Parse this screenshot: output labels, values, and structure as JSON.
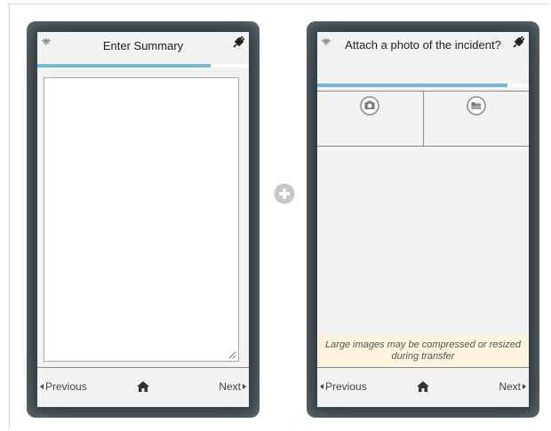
{
  "screens": [
    {
      "header": {
        "title": "Enter Summary",
        "left_icon": "compass-icon",
        "right_icon": "plug-icon"
      },
      "progress_fraction": 0.82,
      "summary_value": "",
      "footer": {
        "previous_label": "Previous",
        "home_icon": "home-icon",
        "next_label": "Next"
      }
    },
    {
      "header": {
        "title": "Attach a photo of the incident?",
        "left_icon": "compass-icon",
        "right_icon": "plug-icon"
      },
      "progress_fraction": 0.9,
      "photo_options": [
        {
          "icon": "camera-icon"
        },
        {
          "icon": "folder-icon"
        }
      ],
      "note": "Large images may be compressed or resized during transfer",
      "footer": {
        "previous_label": "Previous",
        "home_icon": "home-icon",
        "next_label": "Next"
      }
    }
  ],
  "add_button_icon": "plus-circle-icon",
  "colors": {
    "progress": "#74bad6",
    "device_frame": "#2a353b",
    "note_bg": "#fcf3dc"
  }
}
